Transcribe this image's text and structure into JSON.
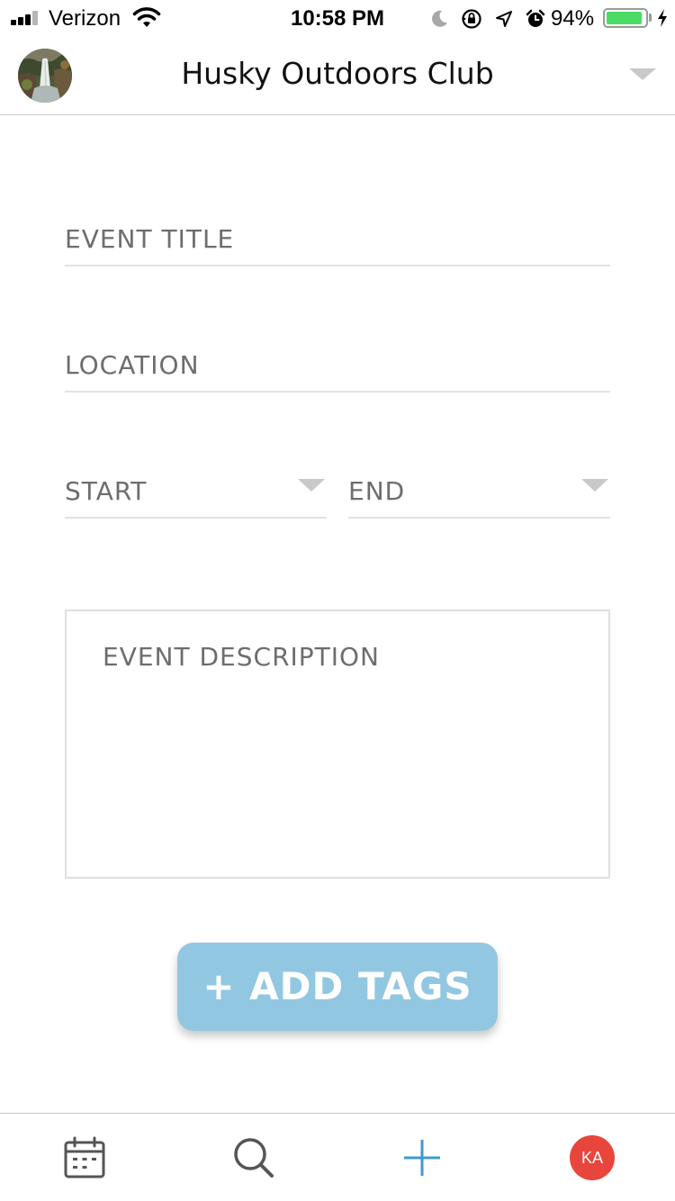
{
  "status_bar": {
    "carrier": "Verizon",
    "time": "10:58 PM",
    "battery_percent": "94%",
    "battery_level": 0.94,
    "icons": [
      "signal-icon",
      "wifi-icon",
      "moon-icon",
      "rotation-lock-icon",
      "location-icon",
      "alarm-icon",
      "battery-icon",
      "charging-icon"
    ]
  },
  "header": {
    "title": "Husky Outdoors Club",
    "avatar_icon": "waterfall-avatar",
    "dropdown_icon": "caret-down-icon"
  },
  "form": {
    "title_label": "EVENT TITLE",
    "location_label": "LOCATION",
    "start_label": "START",
    "end_label": "END",
    "description_label": "EVENT DESCRIPTION",
    "add_tags_label": "+ ADD TAGS"
  },
  "tab_bar": {
    "items": [
      {
        "icon": "calendar-icon"
      },
      {
        "icon": "search-icon"
      },
      {
        "icon": "plus-icon"
      },
      {
        "initials": "KA"
      }
    ]
  },
  "colors": {
    "accent_blue": "#3d9bd0",
    "button_blue": "#92c7e2",
    "profile_red": "#e8463c",
    "label_gray": "#6d6d6d",
    "battery_green": "#4cd964"
  }
}
